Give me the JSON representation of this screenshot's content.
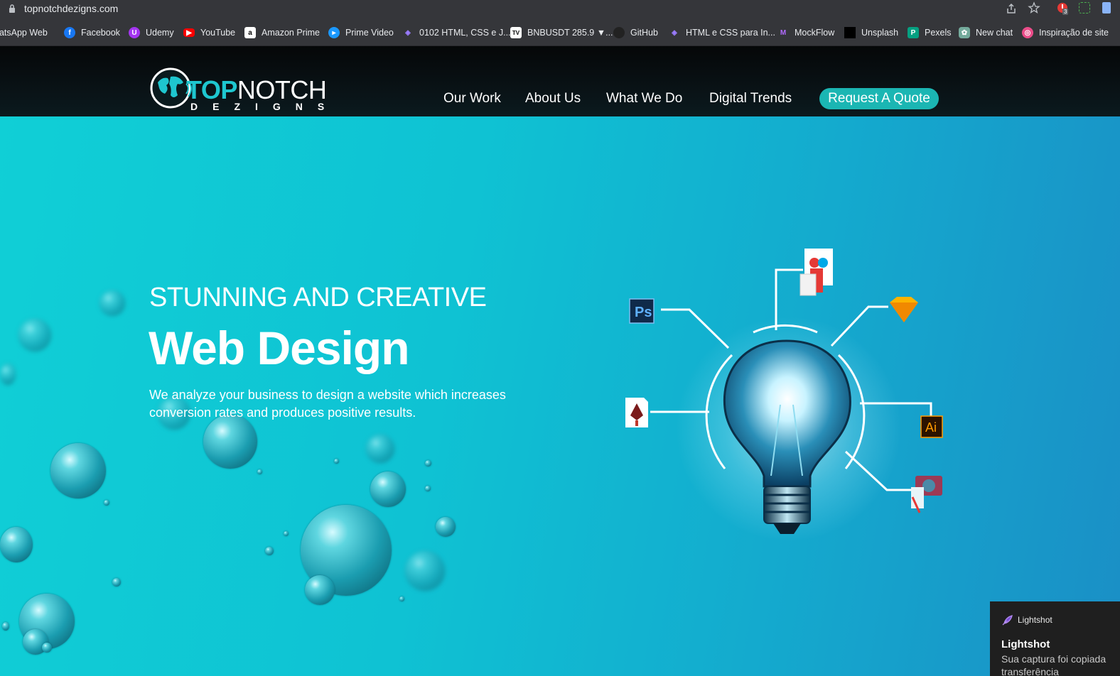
{
  "browser": {
    "url": "topnotchdezigns.com",
    "extension_badge": "3",
    "bookmarks": [
      {
        "label": "hatsApp Web",
        "icon": "whatsapp-icon",
        "color": "#25d366"
      },
      {
        "label": "Facebook",
        "icon": "facebook-icon",
        "color": "#1877f2"
      },
      {
        "label": "Udemy",
        "icon": "udemy-icon",
        "color": "#a435f0"
      },
      {
        "label": "YouTube",
        "icon": "youtube-icon",
        "color": "#ff0000"
      },
      {
        "label": "Amazon Prime",
        "icon": "amazon-icon",
        "color": "#ffffff"
      },
      {
        "label": "Prime Video",
        "icon": "prime-video-icon",
        "color": "#1a98ff"
      },
      {
        "label": "0102 HTML, CSS e J...",
        "icon": "alura-icon",
        "color": "#7b5cff"
      },
      {
        "label": "BNBUSDT 285.9 ▼...",
        "icon": "tradingview-icon",
        "color": "#ffffff"
      },
      {
        "label": "GitHub",
        "icon": "github-icon",
        "color": "#222222"
      },
      {
        "label": "HTML e CSS para In...",
        "icon": "alura-icon",
        "color": "#7b5cff"
      },
      {
        "label": "MockFlow",
        "icon": "mockflow-icon",
        "color": "#8a3ffc"
      },
      {
        "label": "Unsplash",
        "icon": "unsplash-icon",
        "color": "#000000"
      },
      {
        "label": "Pexels",
        "icon": "pexels-icon",
        "color": "#05a081"
      },
      {
        "label": "New chat",
        "icon": "chatgpt-icon",
        "color": "#74aa9c"
      },
      {
        "label": "Inspiração de site",
        "icon": "dribbble-icon",
        "color": "#ea4c89"
      }
    ]
  },
  "site": {
    "logo": {
      "top": "TOP",
      "notch": "NOTCH",
      "sub": "DEZIGNS"
    },
    "nav": [
      "Our Work",
      "About Us",
      "What We Do",
      "Digital Trends"
    ],
    "cta": "Request A Quote",
    "accent_color": "#1bb6b3"
  },
  "hero": {
    "kicker": "STUNNING AND CREATIVE",
    "title": "Web Design",
    "description": "We analyze your business to design a website which increases conversion rates and produces positive results.",
    "tool_icons": [
      "photoshop-icon",
      "document-icon",
      "sketch-icon",
      "pen-tool-icon",
      "illustrator-icon",
      "camera-icon",
      "lightbulb-icon"
    ],
    "ps_label": "Ps",
    "ai_label": "Ai"
  },
  "toast": {
    "app": "Lightshot",
    "title": "Lightshot",
    "message": "Sua captura foi copiada transferência"
  }
}
